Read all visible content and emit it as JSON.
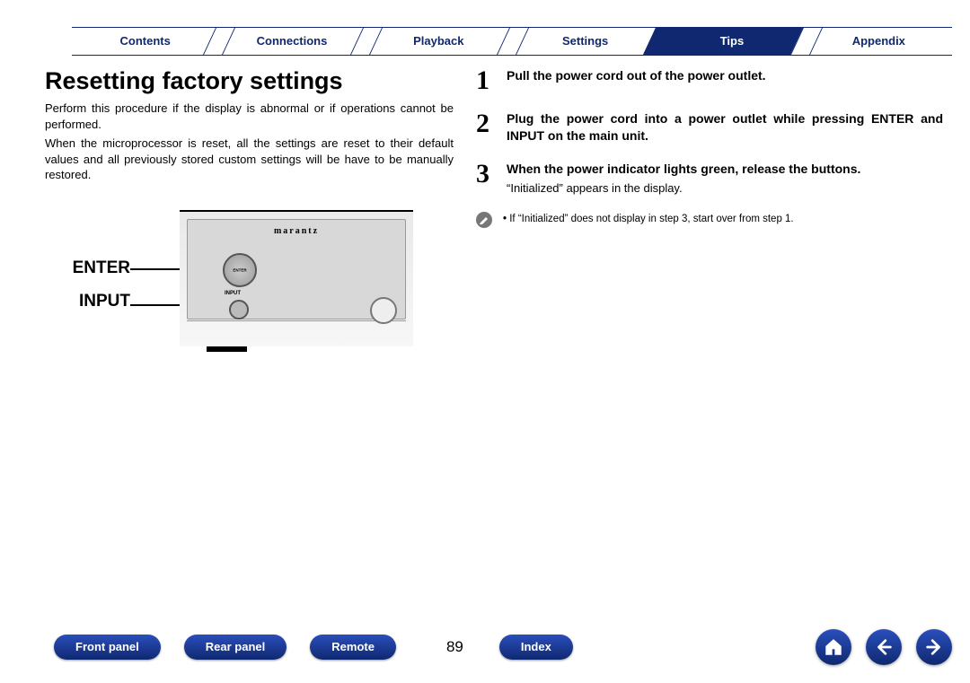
{
  "topnav": {
    "items": [
      "Contents",
      "Connections",
      "Playback",
      "Settings",
      "Tips",
      "Appendix"
    ],
    "active_index": 4
  },
  "left": {
    "title": "Resetting factory settings",
    "para1": "Perform this procedure if the display is abnormal or if operations cannot be performed.",
    "para2": "When the microprocessor is reset, all the settings are reset to their default values and all previously stored custom settings will be have to be manually restored.",
    "label_enter": "ENTER",
    "label_input": "INPUT",
    "device_brand": "marantz"
  },
  "steps": [
    {
      "n": "1",
      "body": "Pull the power cord out of the power outlet."
    },
    {
      "n": "2",
      "body": "Plug the power cord into a power outlet while pressing ENTER and INPUT on the main unit."
    },
    {
      "n": "3",
      "body": "When the power indicator lights green, release the buttons.",
      "sub": "“Initialized” appears in the display."
    }
  ],
  "note": "If “Initialized” does not display in step 3, start over from step 1.",
  "bottomnav": {
    "pills": [
      "Front panel",
      "Rear panel",
      "Remote"
    ],
    "index_pill": "Index",
    "page": "89"
  }
}
